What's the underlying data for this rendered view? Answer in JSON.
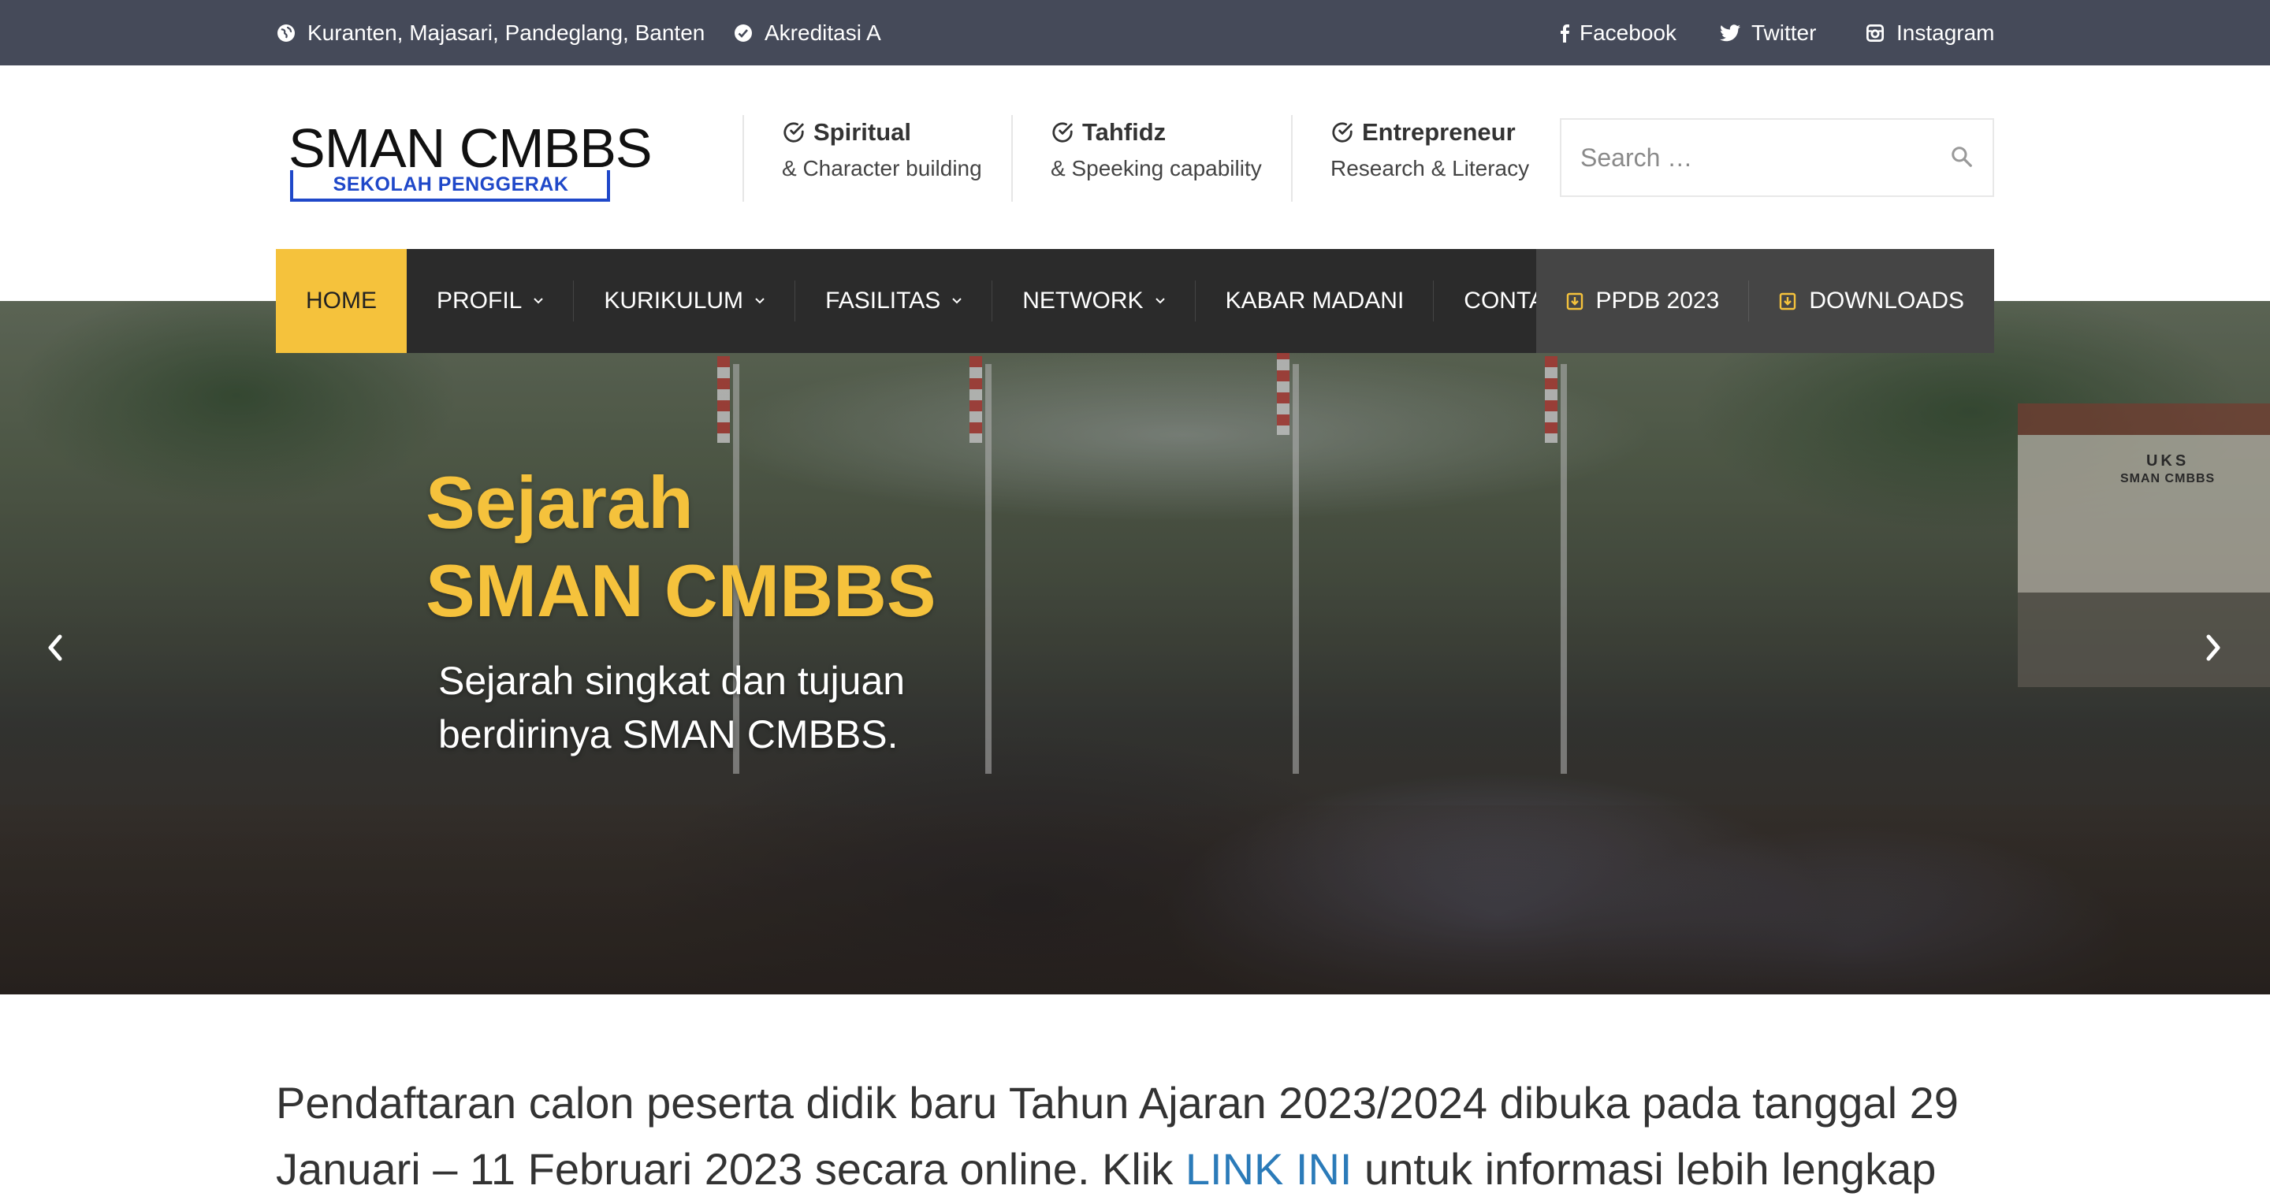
{
  "topbar": {
    "location": "Kuranten, Majasari, Pandeglang, Banten",
    "accreditation": "Akreditasi A",
    "social": {
      "facebook": "Facebook",
      "twitter": "Twitter",
      "instagram": "Instagram"
    }
  },
  "logo": {
    "name": "SMAN CMBBS",
    "tagline": "SEKOLAH PENGGERAK"
  },
  "features": [
    {
      "title": "Spiritual",
      "subtitle": "& Character building"
    },
    {
      "title": "Tahfidz",
      "subtitle": "& Speeking capability"
    },
    {
      "title": "Entrepreneur",
      "subtitle": "Research & Literacy"
    }
  ],
  "search": {
    "placeholder": "Search …"
  },
  "nav": {
    "items": [
      {
        "label": "Home",
        "active": true
      },
      {
        "label": "Profil",
        "dropdown": true
      },
      {
        "label": "Kurikulum",
        "dropdown": true
      },
      {
        "label": "Fasilitas",
        "dropdown": true
      },
      {
        "label": "Network",
        "dropdown": true
      },
      {
        "label": "Kabar Madani"
      },
      {
        "label": "Contact"
      }
    ],
    "right": [
      {
        "label": "PPDB 2023"
      },
      {
        "label": "Downloads"
      }
    ]
  },
  "hero": {
    "title_line1": "Sejarah",
    "title_line2": "SMAN CMBBS",
    "subtitle": "Sejarah singkat dan tujuan berdirinya SMAN CMBBS.",
    "photo_sign_line1": "UKS",
    "photo_sign_line2": "SMAN CMBBS"
  },
  "announcement": {
    "text_before": "Pendaftaran calon peserta didik baru Tahun Ajaran 2023/2024 dibuka pada tanggal 29 Januari – 11 Februari 2023 secara online. Klik ",
    "link_text": "LINK INI",
    "text_after": " untuk informasi lebih lengkap"
  },
  "colors": {
    "topbar_bg": "#454a59",
    "accent": "#f5c23c",
    "nav_bg": "#2b2b2b",
    "link": "#2b7bb9",
    "logo_blue": "#1f48c9"
  },
  "icons": {
    "location": "globe-icon",
    "accreditation": "check-circle-icon",
    "facebook": "facebook-icon",
    "twitter": "twitter-icon",
    "instagram": "instagram-icon",
    "feature": "check-circle-outline-icon",
    "search": "search-icon",
    "download": "download-icon",
    "slider_prev": "chevron-left-icon",
    "slider_next": "chevron-right-icon"
  }
}
